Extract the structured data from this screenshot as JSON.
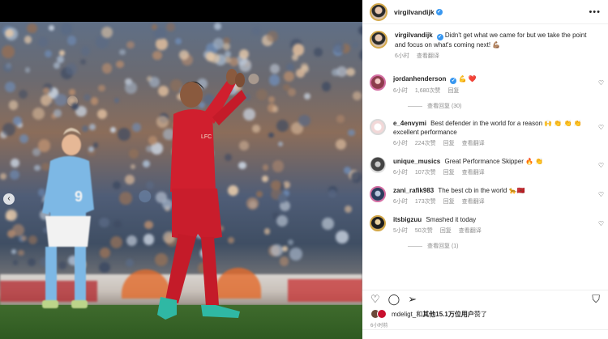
{
  "post": {
    "author": "virgilvandijk",
    "menu_icon": "more-horizontal-icon"
  },
  "caption": {
    "username": "virgilvandijk",
    "text": "Didn't get what we came for but we take the point and focus on what's coming next! 💪🏽",
    "time": "6小时",
    "translate": "查看翻译"
  },
  "comments": [
    {
      "username": "jordanhenderson",
      "text": "💪 ❤️",
      "time": "6小时",
      "likes": "1,680次赞",
      "reply": "回复",
      "replies_label": "查看回复 (30)"
    },
    {
      "username": "e_4envymi",
      "text": "Best defender in the world for a reason 🙌 👏 👏 👏 excellent performance",
      "time": "6小时",
      "likes": "224次赞",
      "reply": "回复",
      "translate": "查看翻译"
    },
    {
      "username": "unique_musics",
      "text": "Great Performance Skipper 🔥 👏",
      "time": "6小时",
      "likes": "107次赞",
      "reply": "回复",
      "translate": "查看翻译"
    },
    {
      "username": "zani_rafik983",
      "text": "The best cb in the world 🐆🇲🇦",
      "time": "6小时",
      "likes": "173次赞",
      "reply": "回复",
      "translate": "查看翻译"
    },
    {
      "username": "itsbigzuu",
      "text": "Smashed it today",
      "time": "5小时",
      "likes": "50次赞",
      "reply": "回复",
      "translate": "查看翻译",
      "replies_label": "查看回复 (1)"
    }
  ],
  "actions": {
    "like_icon": "heart-icon",
    "comment_icon": "comment-icon",
    "share_icon": "send-icon",
    "save_icon": "bookmark-icon"
  },
  "likes_line": {
    "prefix": "mdeligt_和",
    "count": "其他15.1万位用户",
    "suffix": "赞了"
  },
  "date": "6小时前",
  "carousel": {
    "prev_icon": "chevron-left-icon",
    "dots": 5,
    "active_dot": 4
  },
  "colors": {
    "verified": "#3897f0",
    "liverpool_red": "#c8102e",
    "city_blue": "#6cabdd"
  }
}
